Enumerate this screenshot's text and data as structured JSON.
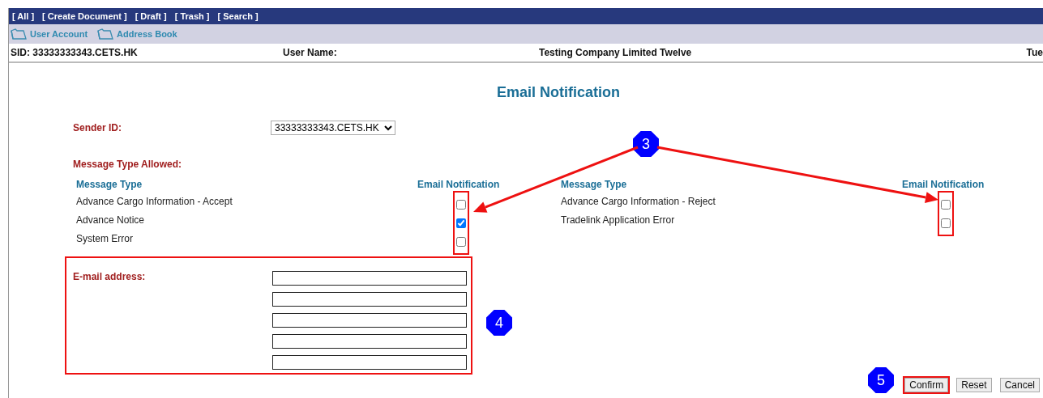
{
  "nav_menu": [
    {
      "label": "[ All ]"
    },
    {
      "label": "[ Create Document ]"
    },
    {
      "label": "[ Draft ]"
    },
    {
      "label": "[ Trash ]"
    },
    {
      "label": "[ Search ]"
    }
  ],
  "toolbar": [
    {
      "label": "User Account"
    },
    {
      "label": "Address Book"
    }
  ],
  "info_bar": {
    "sid": "SID: 33333333343.CETS.HK",
    "user_name_label": "User Name:",
    "company": "Testing Company Limited Twelve",
    "date": "Tue"
  },
  "title": "Email Notification",
  "sender_id": {
    "label": "Sender ID:",
    "value": "33333333343.CETS.HK"
  },
  "message_types": {
    "label": "Message Type Allowed:",
    "groups": [
      {
        "type_header": "Message Type",
        "notification_header": "Email Notification",
        "highlighted": true,
        "rows": [
          {
            "name": "Advance Cargo Information - Accept",
            "checked": false
          },
          {
            "name": "Advance Notice",
            "checked": true
          },
          {
            "name": "System Error",
            "checked": false
          }
        ]
      },
      {
        "type_header": "Message Type",
        "notification_header": "Email Notification",
        "highlighted": true,
        "rows": [
          {
            "name": "Advance Cargo Information - Reject",
            "checked": false
          },
          {
            "name": "Tradelink Application Error",
            "checked": false
          }
        ]
      }
    ]
  },
  "email": {
    "label": "E-mail address:",
    "highlighted": true,
    "fields": [
      {
        "kind": "text"
      },
      {
        "kind": "text"
      },
      {
        "kind": "text"
      },
      {
        "kind": "text"
      },
      {
        "kind": "text"
      }
    ]
  },
  "buttons": [
    {
      "label": "Confirm",
      "highlighted": true
    },
    {
      "label": "Reset",
      "highlighted": false
    },
    {
      "label": "Cancel",
      "highlighted": false
    }
  ],
  "callouts": [
    {
      "label": "3"
    },
    {
      "label": "4"
    },
    {
      "label": "5"
    }
  ]
}
